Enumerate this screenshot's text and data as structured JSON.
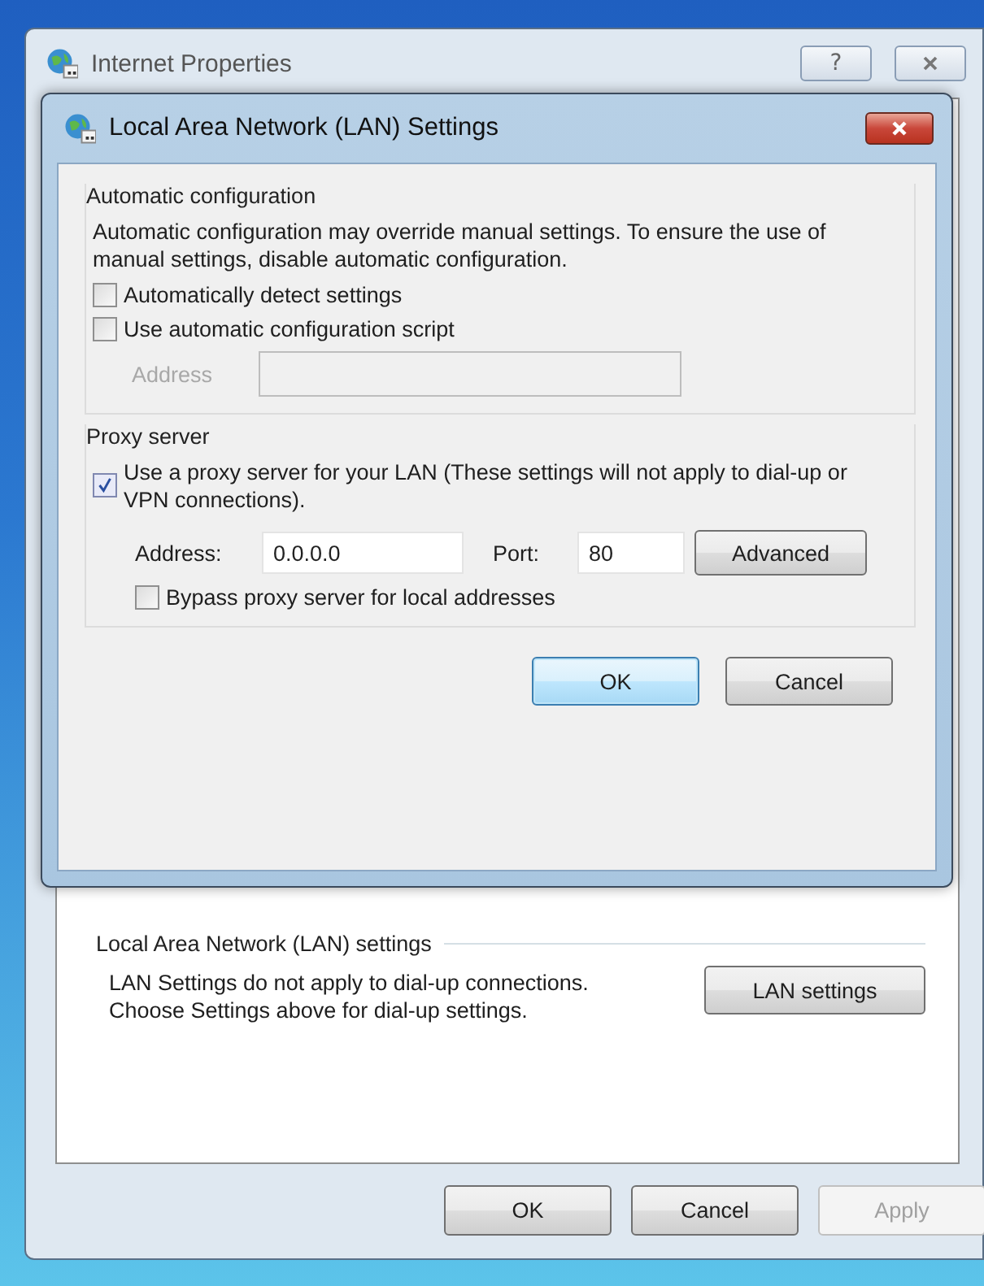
{
  "parent_window": {
    "title": "Internet Properties",
    "help_button": "?",
    "lan_section": {
      "heading": "Local Area Network (LAN) settings",
      "description": [
        "LAN Settings do not apply to dial-up connections.",
        "Choose Settings above for dial-up settings."
      ],
      "button": "LAN settings"
    },
    "buttons": [
      {
        "label": "OK",
        "disabled": false
      },
      {
        "label": "Cancel",
        "disabled": false
      },
      {
        "label": "Apply",
        "disabled": true
      }
    ]
  },
  "dialog": {
    "title": "Local Area Network (LAN) Settings",
    "automatic_configuration": {
      "heading": "Automatic configuration",
      "description": "Automatic configuration may override manual settings.  To ensure the use of manual settings, disable automatic configuration.",
      "checkboxes": [
        {
          "label": "Automatically detect settings",
          "checked": false
        },
        {
          "label": "Use automatic configuration script",
          "checked": false
        }
      ],
      "address": {
        "label": "Address",
        "disabled": true
      }
    },
    "proxy_server": {
      "heading": "Proxy server",
      "use_proxy": {
        "label": "Use a proxy server for your LAN (These settings will not apply to dial-up or VPN connections).",
        "checked": true
      },
      "address_label": "Address:",
      "address_value": "0.0.0.0",
      "port_label": "Port:",
      "port_value": "80",
      "advanced_button": "Advanced",
      "bypass": {
        "label": "Bypass proxy server for local addresses",
        "checked": false
      }
    },
    "buttons": [
      {
        "label": "OK",
        "default": true
      },
      {
        "label": "Cancel",
        "default": false
      }
    ]
  }
}
